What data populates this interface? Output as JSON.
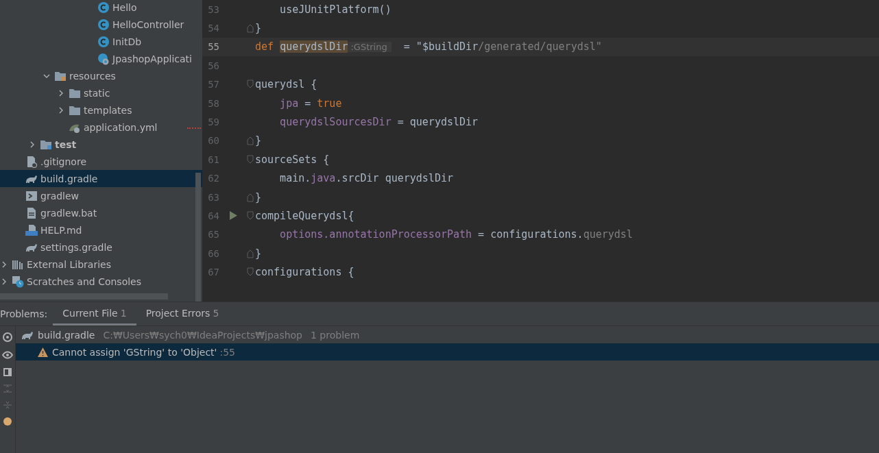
{
  "project_tree": {
    "items": [
      {
        "children": [
          {
            "children": [
              {
                "children": [
                  {
                    "children": [
                      {
                        "children": [
                          {
                            "children": [
                              {
                                "label": "Hello",
                                "kind": "class"
                              },
                              {
                                "label": "HelloController",
                                "kind": "class"
                              },
                              {
                                "label": "InitDb",
                                "kind": "class"
                              },
                              {
                                "label": "JpashopApplicati",
                                "kind": "app"
                              }
                            ]
                          }
                        ]
                      }
                    ]
                  },
                  {
                    "label": "resources",
                    "kind": "resources",
                    "expanded": true,
                    "children": [
                      {
                        "label": "static",
                        "kind": "folder",
                        "expanded": false
                      },
                      {
                        "label": "templates",
                        "kind": "folder",
                        "expanded": false
                      },
                      {
                        "label": "application.yml",
                        "kind": "yml",
                        "warning": true
                      }
                    ]
                  }
                ]
              },
              {
                "label": "test",
                "kind": "test",
                "expanded": false,
                "bold": true
              }
            ]
          },
          {
            "label": ".gitignore",
            "kind": "ignore"
          },
          {
            "label": "build.gradle",
            "kind": "gradle",
            "selected": true
          },
          {
            "label": "gradlew",
            "kind": "shell"
          },
          {
            "label": "gradlew.bat",
            "kind": "file"
          },
          {
            "label": "HELP.md",
            "kind": "md"
          },
          {
            "label": "settings.gradle",
            "kind": "gradle"
          }
        ]
      },
      {
        "label": "External Libraries",
        "kind": "libs",
        "expanded": false
      },
      {
        "label": "Scratches and Consoles",
        "kind": "scratch",
        "expanded": false
      }
    ]
  },
  "editor": {
    "lines": [
      {
        "number": "53",
        "kind": "plain",
        "tokens": [
          {
            "kind": "text",
            "text": "    useJUnitPlatform()"
          }
        ]
      },
      {
        "number": "54",
        "kind": "fold_end",
        "tokens": [
          {
            "kind": "text",
            "text": "}"
          }
        ]
      },
      {
        "number": "55",
        "kind": "plain",
        "current": true,
        "tokens": [
          {
            "kind": "keyword",
            "text": "def "
          },
          {
            "kind": "highlight",
            "text": "querydslDir"
          },
          {
            "kind": "hint",
            "text": ":GString"
          },
          {
            "kind": "text",
            "text": "  = \"$buildDir"
          },
          {
            "kind": "muted",
            "text": "/generated/querydsl\""
          }
        ]
      },
      {
        "number": "56",
        "kind": "plain"
      },
      {
        "number": "57",
        "kind": "fold_start",
        "tokens": [
          {
            "kind": "text",
            "text": "querydsl {"
          }
        ]
      },
      {
        "number": "58",
        "kind": "plain",
        "tokens": [
          {
            "kind": "property",
            "text": "    jpa"
          },
          {
            "kind": "text",
            "text": " = "
          },
          {
            "kind": "keyword",
            "text": "true"
          }
        ]
      },
      {
        "number": "59",
        "kind": "plain",
        "tokens": [
          {
            "kind": "property",
            "text": "    querydslSourcesDir"
          },
          {
            "kind": "text",
            "text": " = querydslDir"
          }
        ]
      },
      {
        "number": "60",
        "kind": "fold_end",
        "tokens": [
          {
            "kind": "text",
            "text": "}"
          }
        ]
      },
      {
        "number": "61",
        "kind": "fold_start",
        "tokens": [
          {
            "kind": "text",
            "text": "sourceSets {"
          }
        ]
      },
      {
        "number": "62",
        "kind": "plain",
        "tokens": [
          {
            "kind": "text",
            "text": "    main."
          },
          {
            "kind": "property",
            "text": "java"
          },
          {
            "kind": "text",
            "text": ".srcDir querydslDir"
          }
        ]
      },
      {
        "number": "63",
        "kind": "fold_end",
        "tokens": [
          {
            "kind": "text",
            "text": "}"
          }
        ]
      },
      {
        "number": "64",
        "kind": "fold_start",
        "run": true,
        "tokens": [
          {
            "kind": "text",
            "text": "compileQuerydsl{"
          }
        ]
      },
      {
        "number": "65",
        "kind": "plain",
        "tokens": [
          {
            "kind": "property",
            "text": "    options.annotationProcessorPath"
          },
          {
            "kind": "text",
            "text": " = configurations."
          },
          {
            "kind": "muted",
            "text": "querydsl"
          }
        ]
      },
      {
        "number": "66",
        "kind": "fold_end",
        "tokens": [
          {
            "kind": "text",
            "text": "}"
          }
        ]
      },
      {
        "number": "67",
        "kind": "fold_start",
        "tokens": [
          {
            "kind": "text",
            "text": "configurations {"
          }
        ]
      }
    ]
  },
  "problems": {
    "title": "Problems:",
    "tabs": [
      {
        "label": "Current File",
        "count": "1",
        "selected": true
      },
      {
        "label": "Project Errors",
        "count": "5",
        "selected": false
      }
    ],
    "file": {
      "name": "build.gradle",
      "path": "C:₩Users₩sych0₩IdeaProjects₩jpashop",
      "summary": "1 problem"
    },
    "items": [
      {
        "message": "Cannot assign 'GString' to 'Object'",
        "line": ":55",
        "kind": "warning",
        "selected": true
      }
    ]
  }
}
